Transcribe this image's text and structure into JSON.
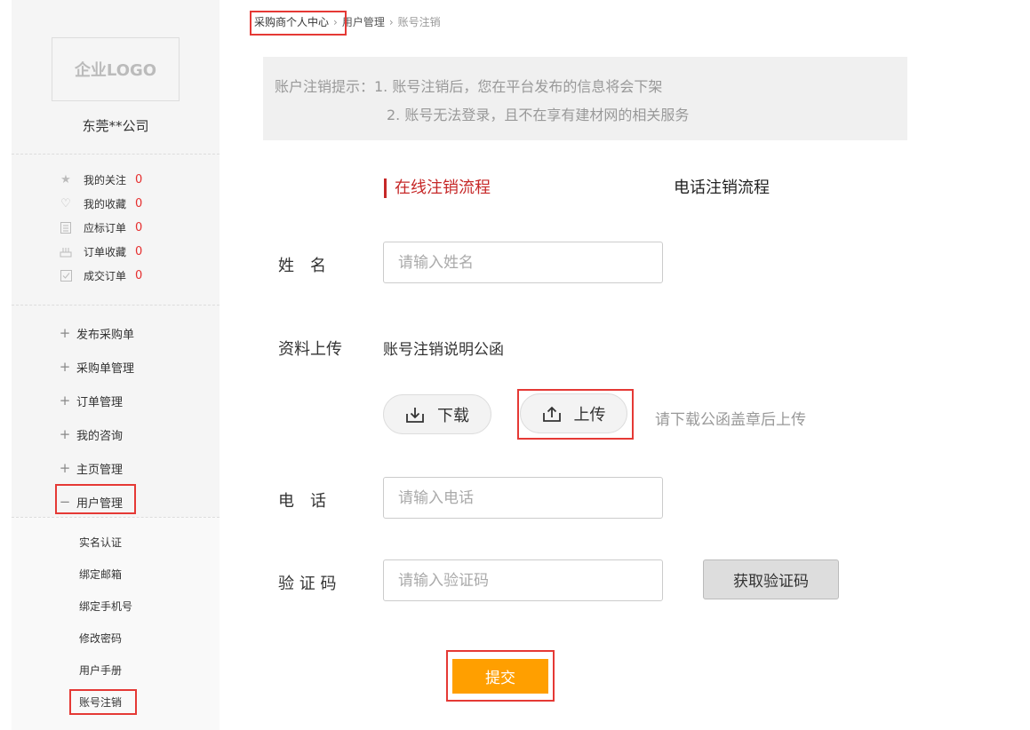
{
  "sidebar": {
    "logo_text": "企业LOGO",
    "company_name": "东莞**公司",
    "stats": [
      {
        "label": "我的关注",
        "count": "0",
        "icon": "star-icon"
      },
      {
        "label": "我的收藏",
        "count": "0",
        "icon": "heart-icon"
      },
      {
        "label": "应标订单",
        "count": "0",
        "icon": "document-icon"
      },
      {
        "label": "订单收藏",
        "count": "0",
        "icon": "stack-icon"
      },
      {
        "label": "成交订单",
        "count": "0",
        "icon": "check-icon"
      }
    ],
    "menu": [
      {
        "label": "发布采购单",
        "sign": "+"
      },
      {
        "label": "采购单管理",
        "sign": "+"
      },
      {
        "label": "订单管理",
        "sign": "+"
      },
      {
        "label": "我的咨询",
        "sign": "+"
      },
      {
        "label": "主页管理",
        "sign": "+"
      },
      {
        "label": "用户管理",
        "sign": "−"
      }
    ],
    "submenu": [
      "实名认证",
      "绑定邮箱",
      "绑定手机号",
      "修改密码",
      "用户手册",
      "账号注销"
    ]
  },
  "breadcrumb": {
    "items": [
      "采购商个人中心",
      "用户管理",
      "账号注销"
    ],
    "separator": "›"
  },
  "notice": {
    "line1": "账户注销提示：1. 账号注销后，您在平台发布的信息将会下架",
    "line2": "2. 账号无法登录，且不在享有建材网的相关服务"
  },
  "tabs": {
    "online": "在线注销流程",
    "phone": "电话注销流程"
  },
  "form": {
    "name_label": "姓　名",
    "name_placeholder": "请输入姓名",
    "upload_label": "资料上传",
    "doc_name": "账号注销说明公函",
    "download_label": "下载",
    "upload_button": "上传",
    "upload_hint": "请下载公函盖章后上传",
    "phone_label": "电　话",
    "phone_placeholder": "请输入电话",
    "code_label": "验 证 码",
    "code_placeholder": "请输入验证码",
    "get_code": "获取验证码",
    "submit": "提交"
  },
  "colors": {
    "accent_red": "#c62828",
    "count_red": "#e62e2e",
    "submit_orange": "#ff9f00",
    "highlight_box": "#e53935"
  }
}
